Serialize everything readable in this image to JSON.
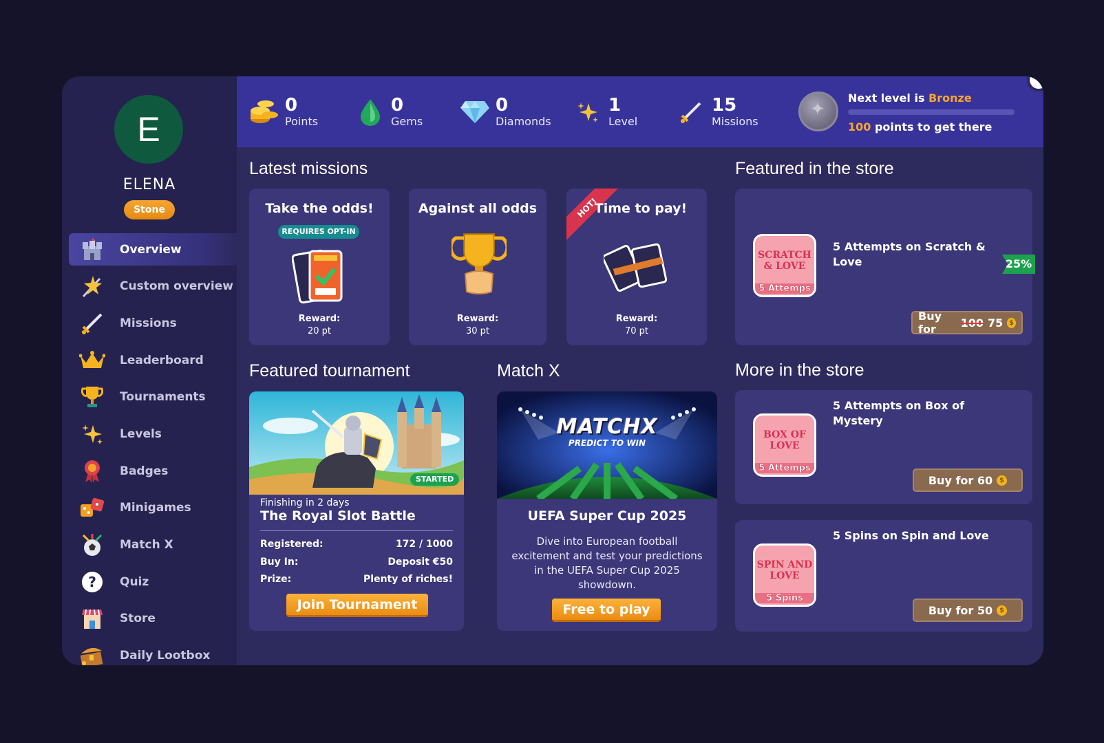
{
  "user": {
    "initial": "E",
    "name": "ELENA",
    "tier": "Stone"
  },
  "nav": [
    {
      "label": "Overview",
      "icon": "castle-icon",
      "active": true
    },
    {
      "label": "Custom overview",
      "icon": "sparkle-wand-icon"
    },
    {
      "label": "Missions",
      "icon": "sword-icon"
    },
    {
      "label": "Leaderboard",
      "icon": "crown-icon"
    },
    {
      "label": "Tournaments",
      "icon": "trophy-icon"
    },
    {
      "label": "Levels",
      "icon": "stars-icon"
    },
    {
      "label": "Badges",
      "icon": "ribbon-badge-icon"
    },
    {
      "label": "Minigames",
      "icon": "dice-icon"
    },
    {
      "label": "Match X",
      "icon": "football-icon"
    },
    {
      "label": "Quiz",
      "icon": "question-icon"
    },
    {
      "label": "Store",
      "icon": "shop-icon"
    },
    {
      "label": "Daily Lootbox",
      "icon": "treasure-chest-icon"
    }
  ],
  "stats": [
    {
      "value": "0",
      "label": "Points",
      "icon": "coins-icon"
    },
    {
      "value": "0",
      "label": "Gems",
      "icon": "gem-icon"
    },
    {
      "value": "0",
      "label": "Diamonds",
      "icon": "diamond-icon"
    },
    {
      "value": "1",
      "label": "Level",
      "icon": "stars-icon"
    },
    {
      "value": "15",
      "label": "Missions",
      "icon": "sword-icon"
    }
  ],
  "level_progress": {
    "prefix": "Next level is ",
    "next_level": "Bronze",
    "points_needed": "100",
    "suffix": " points to get there",
    "progress_fraction": 0
  },
  "sections": {
    "latest_missions": "Latest missions",
    "featured_store": "Featured in the store",
    "featured_tournament": "Featured tournament",
    "match_x": "Match X",
    "more_store": "More in the store"
  },
  "missions": [
    {
      "title": "Take the odds!",
      "badge": "REQUIRES OPT-IN",
      "reward_label": "Reward:",
      "reward": "20 pt"
    },
    {
      "title": "Against all odds",
      "reward_label": "Reward:",
      "reward": "30 pt"
    },
    {
      "title": "Time to pay!",
      "ribbon": "HOT!",
      "reward_label": "Reward:",
      "reward": "70 pt"
    }
  ],
  "featured_store": {
    "discount": "25%",
    "title": "5 Attempts on Scratch & Love",
    "thumb_text": "SCRATCH & LOVE",
    "thumb_bottom": "5 Attemps",
    "buy_prefix": "Buy for ",
    "old_price": "100",
    "price": "75"
  },
  "tournament": {
    "status": "STARTED",
    "finishing": "Finishing in 2 days",
    "name": "The Royal Slot Battle",
    "rows": [
      {
        "label": "Registered:",
        "value": "172 / 1000"
      },
      {
        "label": "Buy In:",
        "value": "Deposit €50"
      },
      {
        "label": "Prize:",
        "value": "Plenty of riches!"
      }
    ],
    "button": "Join Tournament"
  },
  "matchx": {
    "logo": "MATCHX",
    "tagline": "PREDICT TO WIN",
    "title": "UEFA Super Cup 2025",
    "description": "Dive into European football excitement and test your predictions in the UEFA Super Cup 2025 showdown.",
    "button": "Free to play"
  },
  "more_store": [
    {
      "title": "5 Attempts on Box of Mystery",
      "thumb_text": "BOX OF LOVE",
      "thumb_bottom": "5 Attemps",
      "button": "Buy for 60"
    },
    {
      "title": "5 Spins on Spin and Love",
      "thumb_text": "SPIN AND LOVE",
      "thumb_bottom": "5 Spins",
      "button": "Buy for 50"
    }
  ],
  "colors": {
    "background": "#15132a",
    "panel": "#2d2a5e",
    "statsbar": "#38339b",
    "accent_orange": "#f6a531",
    "card": "#3b3779"
  }
}
